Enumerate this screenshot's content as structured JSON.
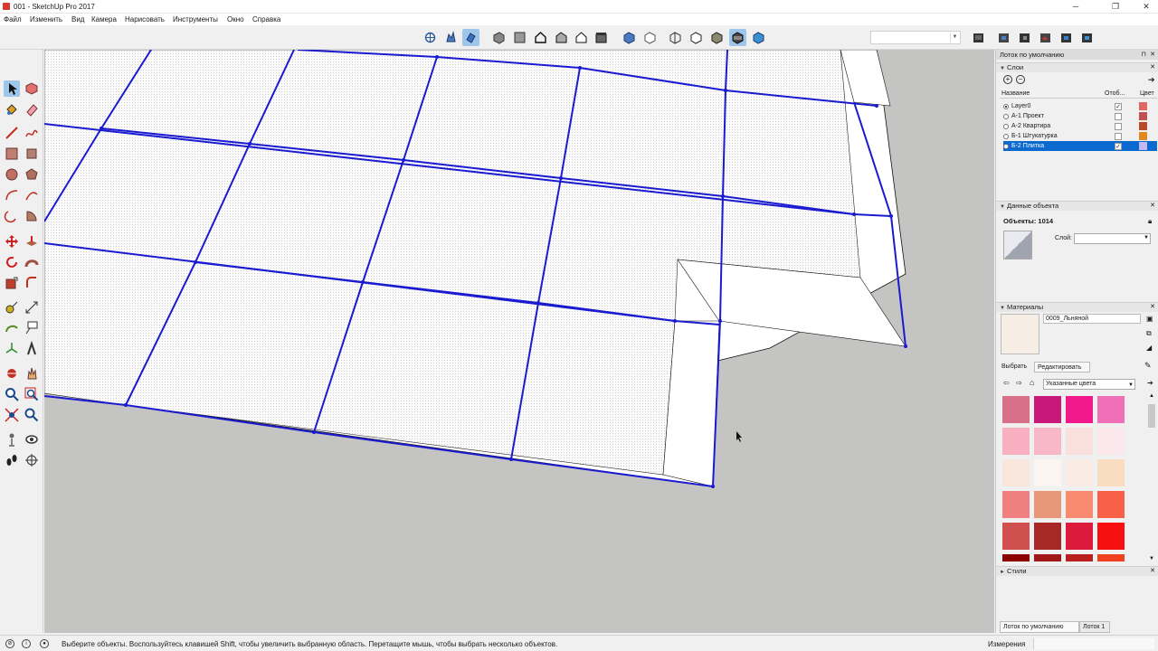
{
  "window": {
    "title": "001 - SketchUp Pro 2017",
    "minimize": "─",
    "maximize": "❐",
    "close": "✕"
  },
  "menu": [
    "Файл",
    "Изменить",
    "Вид",
    "Камера",
    "Нарисовать",
    "Инструменты",
    "Окно",
    "Справка"
  ],
  "tray": {
    "title": "Лоток по умолчанию",
    "layers": {
      "title": "Слои",
      "col_name": "Название",
      "col_visible": "Отоб...",
      "col_color": "Цвет",
      "rows": [
        {
          "name": "Layer0",
          "active": true,
          "visible": true,
          "color": "#e06666"
        },
        {
          "name": "А-1 Проект",
          "active": false,
          "visible": false,
          "color": "#c0504d"
        },
        {
          "name": "А-2 Квартира",
          "active": false,
          "visible": false,
          "color": "#b94a2a"
        },
        {
          "name": "Б-1 Штукатурка",
          "active": false,
          "visible": false,
          "color": "#e08a1e"
        },
        {
          "name": "Б-2 Плитка",
          "active": false,
          "visible": true,
          "color": "#c5b8f0",
          "selected": true
        }
      ]
    },
    "entity": {
      "title": "Данные объекта",
      "objects": "Объекты: 1014",
      "layer_label": "Слой:"
    },
    "materials": {
      "title": "Материалы",
      "name": "0009_Льняной",
      "tab_select": "Выбрать",
      "tab_edit": "Редактировать",
      "collection": "Указанные цвета",
      "swatches": [
        "#d9708a",
        "#c8187a",
        "#f0188a",
        "#f070b8",
        "#f8b0c0",
        "#f8b8c8",
        "#fae0dc",
        "#fbe8ec",
        "#f8e6dc",
        "#fcf4f0",
        "#faece4",
        "#fadcc0",
        "#f08080",
        "#e89878",
        "#f88a70",
        "#f86048",
        "#d05050",
        "#a82828",
        "#dc1a3c",
        "#f81010",
        "#8b0000",
        "#a01818",
        "#b82020",
        "#f04020"
      ]
    },
    "styles": {
      "title": "Стили"
    },
    "bottom_tabs": [
      "Лоток по умолчанию",
      "Лоток 1"
    ]
  },
  "status": {
    "message": "Выберите объекты. Воспользуйтесь клавишей Shift, чтобы увеличить выбранную область. Перетащите мышь, чтобы выбрать несколько объектов.",
    "measurements": "Измерения"
  },
  "colors": {
    "viewport_bg": "#c4c4c2",
    "grid_line": "#1a1ad0",
    "selection": "#9dc6ea"
  }
}
